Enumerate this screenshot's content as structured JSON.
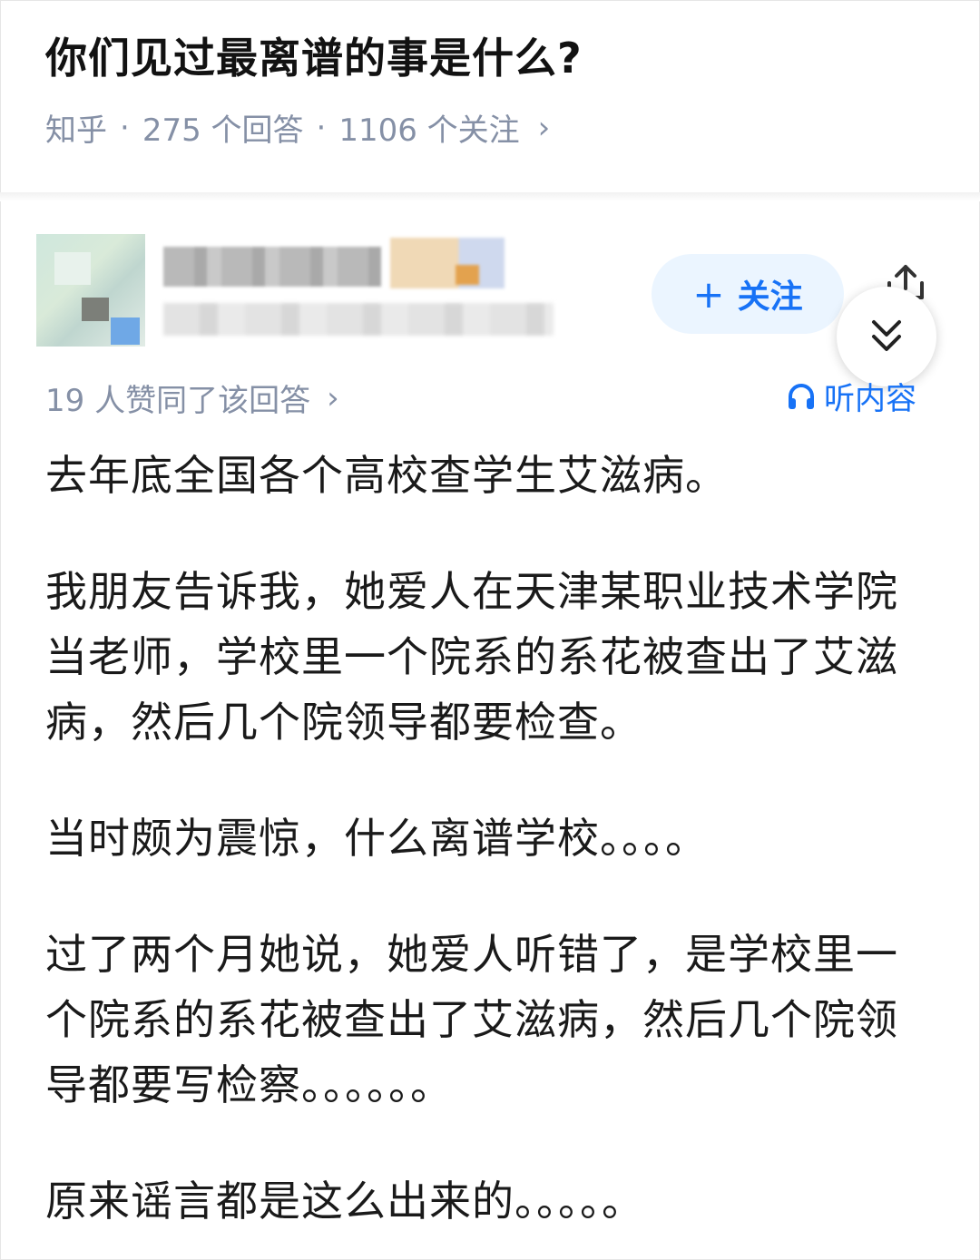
{
  "question": {
    "title": "你们见过最离谱的事是什么?",
    "source": "知乎",
    "separator": "·",
    "answers": "275 个回答",
    "follows": "1106 个关注",
    "chevron": "›"
  },
  "author": {
    "follow_label": "关注",
    "follow_icon": "+"
  },
  "answer_meta": {
    "likes": "19 人赞同了该回答",
    "chevron": "›",
    "listen_label": "听内容"
  },
  "answer": {
    "paragraphs": [
      "去年底全国各个高校查学生艾滋病。",
      "我朋友告诉我，她爱人在天津某职业技术学院当老师，学校里一个院系的系花被查出了艾滋病，然后几个院领导都要检查。",
      "当时颇为震惊，什么离谱学校。。。。",
      "过了两个月她说，她爱人听错了，是学校里一个院系的系花被查出了艾滋病，然后几个院领导都要写检察。。。。。。",
      "原来谣言都是这么出来的。。。。。"
    ]
  },
  "colors": {
    "accent": "#1772f6",
    "meta_gray": "#8590a6",
    "follow_bg": "#ebf5ff"
  },
  "icons": [
    "share-icon",
    "collapse-chevrons-icon",
    "headphones-icon",
    "plus-icon"
  ]
}
